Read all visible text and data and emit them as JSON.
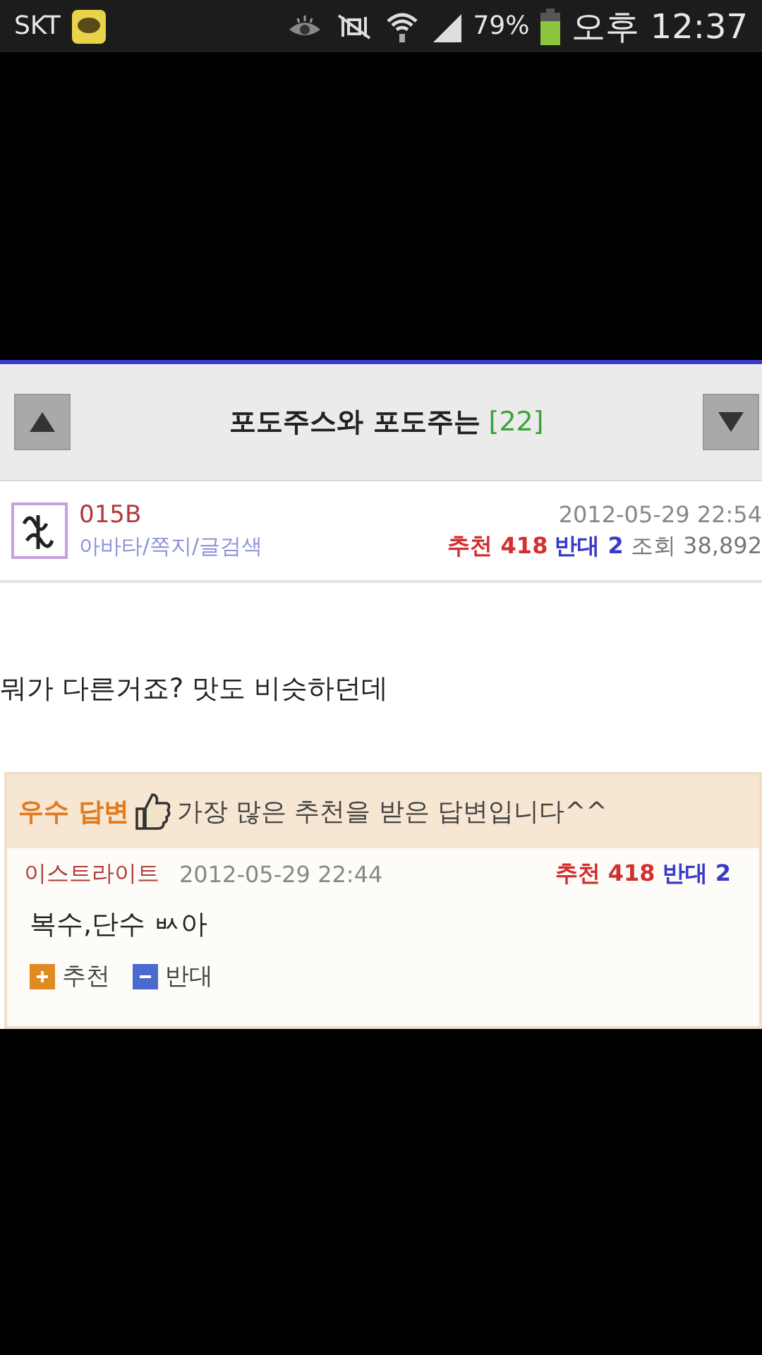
{
  "status_bar": {
    "carrier": "SKT",
    "battery": "79%",
    "time": "오후 12:37"
  },
  "post": {
    "title": "포도주스와 포도주는",
    "comment_count": "[22]",
    "author": "015B",
    "author_links": "아바타/쪽지/글검색",
    "date": "2012-05-29 22:54",
    "recommend_label": "추천",
    "recommend_count": "418",
    "oppose_label": "반대",
    "oppose_count": "2",
    "views_label": "조회",
    "views": "38,892",
    "body": "뭐가 다른거죠? 맛도 비슷하던데"
  },
  "best_answer": {
    "badge": "우수 답변",
    "note": "가장 많은 추천을 받은 답변입니다^^",
    "author": "이스트라이트",
    "date": "2012-05-29 22:44",
    "recommend_label": "추천",
    "recommend_count": "418",
    "oppose_label": "반대",
    "oppose_count": "2",
    "body": "복수,단수 ㅄ아",
    "actions": [
      {
        "kind": "up",
        "label": "추천"
      },
      {
        "kind": "down",
        "label": "반대"
      }
    ]
  }
}
